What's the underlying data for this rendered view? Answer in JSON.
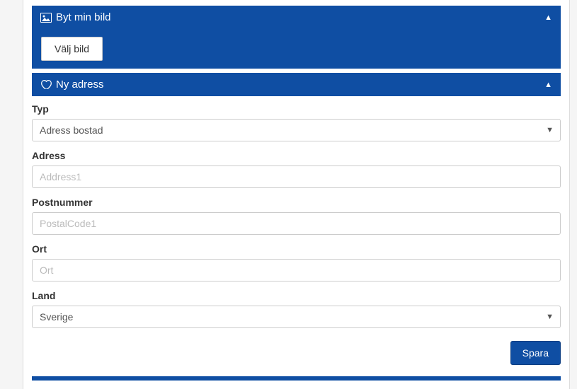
{
  "colors": {
    "primary": "#0f4ea3"
  },
  "panels": {
    "changeImage": {
      "title": "Byt min bild",
      "buttonLabel": "Välj bild"
    },
    "newAddress": {
      "title": "Ny adress"
    }
  },
  "form": {
    "type": {
      "label": "Typ",
      "value": "Adress bostad"
    },
    "address": {
      "label": "Adress",
      "placeholder": "Address1",
      "value": ""
    },
    "postalCode": {
      "label": "Postnummer",
      "placeholder": "PostalCode1",
      "value": ""
    },
    "city": {
      "label": "Ort",
      "placeholder": "Ort",
      "value": ""
    },
    "country": {
      "label": "Land",
      "value": "Sverige"
    }
  },
  "actions": {
    "save": "Spara"
  }
}
